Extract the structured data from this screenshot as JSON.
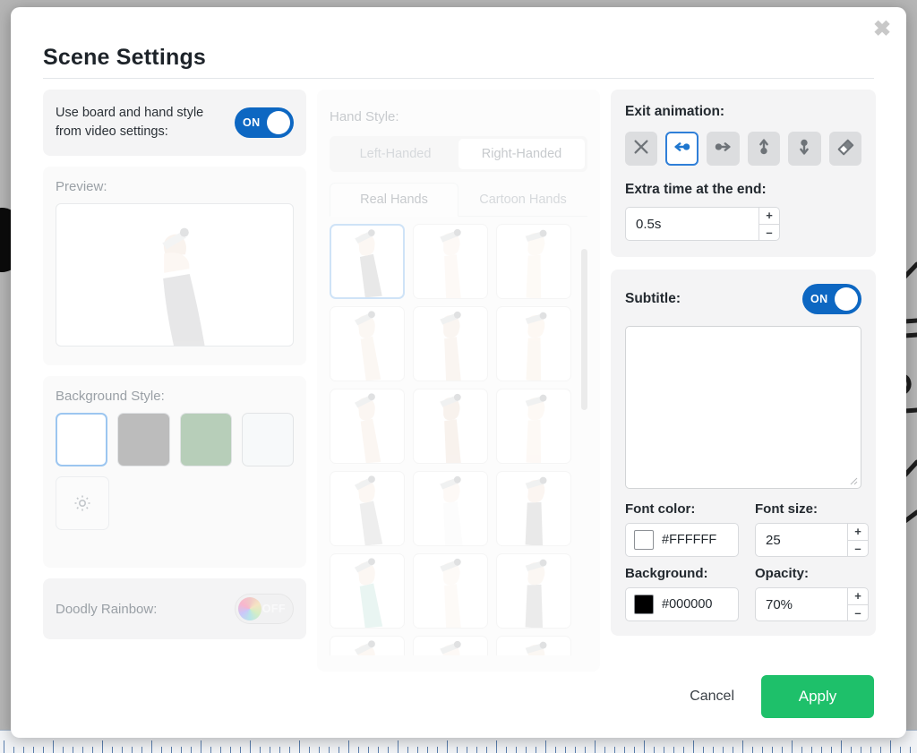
{
  "dialog": {
    "title": "Scene Settings",
    "close_icon": "close-icon"
  },
  "left": {
    "use_video_style": {
      "label": "Use board and hand style from video settings:",
      "toggle_state": "ON"
    },
    "preview": {
      "label": "Preview:"
    },
    "background_style": {
      "label": "Background Style:",
      "swatches": [
        {
          "name": "white",
          "color": "#ffffff",
          "selected": true
        },
        {
          "name": "grey",
          "color": "#bcbcbc",
          "selected": false
        },
        {
          "name": "sage-green",
          "color": "#b7ceb9",
          "selected": false
        },
        {
          "name": "off-white",
          "color": "#f7f9fa",
          "selected": false
        }
      ],
      "custom_icon": "gear-icon"
    },
    "doodly_rainbow": {
      "label": "Doodly Rainbow:",
      "toggle_state": "OFF"
    }
  },
  "middle": {
    "hand_style_label": "Hand Style:",
    "handedness": [
      {
        "label": "Left-Handed",
        "active": false
      },
      {
        "label": "Right-Handed",
        "active": true
      }
    ],
    "tabs": [
      {
        "label": "Real Hands",
        "active": true
      },
      {
        "label": "Cartoon Hands",
        "active": false
      }
    ],
    "hand_thumbnails": [
      {
        "sleeve": "#7a7a7a",
        "skin": "#f2d2bc",
        "selected": true
      },
      {
        "sleeve": "none",
        "skin": "#f6ddc9",
        "selected": false
      },
      {
        "sleeve": "none",
        "skin": "#f7e0cd",
        "selected": false
      },
      {
        "sleeve": "none",
        "skin": "#eccfb8",
        "selected": false
      },
      {
        "sleeve": "none",
        "skin": "#e4c4ab",
        "selected": false
      },
      {
        "sleeve": "none",
        "skin": "#f3d6bd",
        "selected": false
      },
      {
        "sleeve": "none",
        "skin": "#e9cbb2",
        "selected": false
      },
      {
        "sleeve": "none",
        "skin": "#d9b69a",
        "selected": false
      },
      {
        "sleeve": "none",
        "skin": "#f6dcc3",
        "selected": false
      },
      {
        "sleeve": "#9c9c9c",
        "skin": "#f0d0b8",
        "selected": false
      },
      {
        "sleeve": "#f0f0f0",
        "skin": "#f6ddc9",
        "selected": false
      },
      {
        "sleeve": "#7d7d7d",
        "skin": "#e6c6ad",
        "selected": false
      },
      {
        "sleeve": "#7fc6b4",
        "skin": "#f2d2bc",
        "selected": false
      },
      {
        "sleeve": "none",
        "skin": "#f8e2d0",
        "selected": false
      },
      {
        "sleeve": "#8a8a8a",
        "skin": "#eccfb8",
        "selected": false
      },
      {
        "sleeve": "none",
        "skin": "#f2d2bc",
        "selected": false
      },
      {
        "sleeve": "none",
        "skin": "#f6ddc9",
        "selected": false
      },
      {
        "sleeve": "none",
        "skin": "#eccfb8",
        "selected": false
      }
    ]
  },
  "right": {
    "exit_animation": {
      "label": "Exit animation:",
      "options": [
        {
          "name": "none",
          "icon": "x-icon",
          "selected": false
        },
        {
          "name": "slide-left",
          "icon": "arrow-left-ball-icon",
          "selected": true
        },
        {
          "name": "slide-right",
          "icon": "arrow-right-ball-icon",
          "selected": false
        },
        {
          "name": "slide-up",
          "icon": "arrow-up-ball-icon",
          "selected": false
        },
        {
          "name": "slide-down",
          "icon": "arrow-down-ball-icon",
          "selected": false
        },
        {
          "name": "erase",
          "icon": "eraser-icon",
          "selected": false
        }
      ]
    },
    "extra_time": {
      "label": "Extra time at the end:",
      "value": "0.5s",
      "increment_label": "+",
      "decrement_label": "–"
    },
    "subtitle": {
      "label": "Subtitle:",
      "toggle_state": "ON",
      "text_value": "",
      "font_color": {
        "label": "Font color:",
        "hex": "#FFFFFF",
        "swatch": "#ffffff"
      },
      "font_size": {
        "label": "Font size:",
        "value": "25",
        "increment_label": "+",
        "decrement_label": "–"
      },
      "background": {
        "label": "Background:",
        "hex": "#000000",
        "swatch": "#000000"
      },
      "opacity": {
        "label": "Opacity:",
        "value": "70%",
        "increment_label": "+",
        "decrement_label": "–"
      }
    }
  },
  "footer": {
    "cancel_label": "Cancel",
    "apply_label": "Apply",
    "apply_color": "#1ec06a"
  },
  "theme": {
    "toggle_on_color": "#0d67c2",
    "selected_border": "#2f7fd8",
    "panel_bg": "#f4f4f5"
  }
}
